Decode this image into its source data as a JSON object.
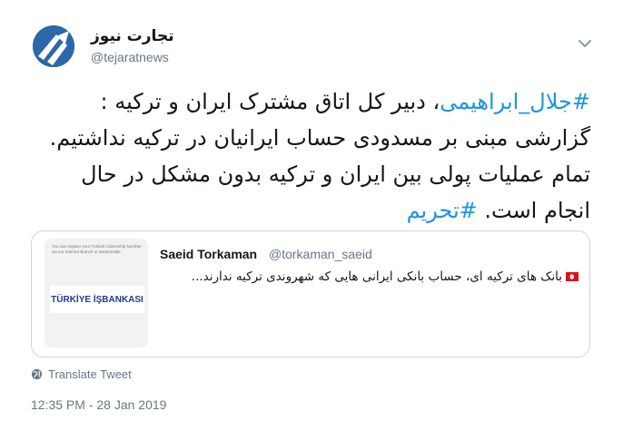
{
  "author": {
    "display_name": "تجارت نیوز",
    "handle": "@tejaratnews",
    "avatar_icon": "tejaratnews-logo-icon",
    "brand_color": "#2b68a8"
  },
  "menu": {
    "icon": "chevron-down-icon"
  },
  "tweet": {
    "hashtag_1": "#جلال_ابراهیمی",
    "body": "، دبیر کل اتاق مشترک ایران و ترکیه : گزارشی مبنی بر مسدودی حساب ایرانیان در ترکیه نداشتیم. تمام عملیات پولی بین ایران و ترکیه بدون مشکل در حال انجام است. ",
    "hashtag_2": "#تحریم",
    "link_color": "#1b95e0"
  },
  "quoted_tweet": {
    "display_name": "Saeid Torkaman",
    "handle": "@torkaman_saeid",
    "flag_icon": "turkey-flag-icon",
    "text": "بانک های ترکیه ای، حساب بانکی ایرانی هایی که شهروندی ترکیه ندارند...",
    "thumbnail": {
      "caption": "You can register your Turkish Citizenship Number via our Internet Branch or Bankamatik.",
      "logo_text": "TÜRKİYE İŞBANKASI"
    }
  },
  "translate_label": "Translate Tweet",
  "timestamp": "12:35 PM - 28 Jan 2019"
}
